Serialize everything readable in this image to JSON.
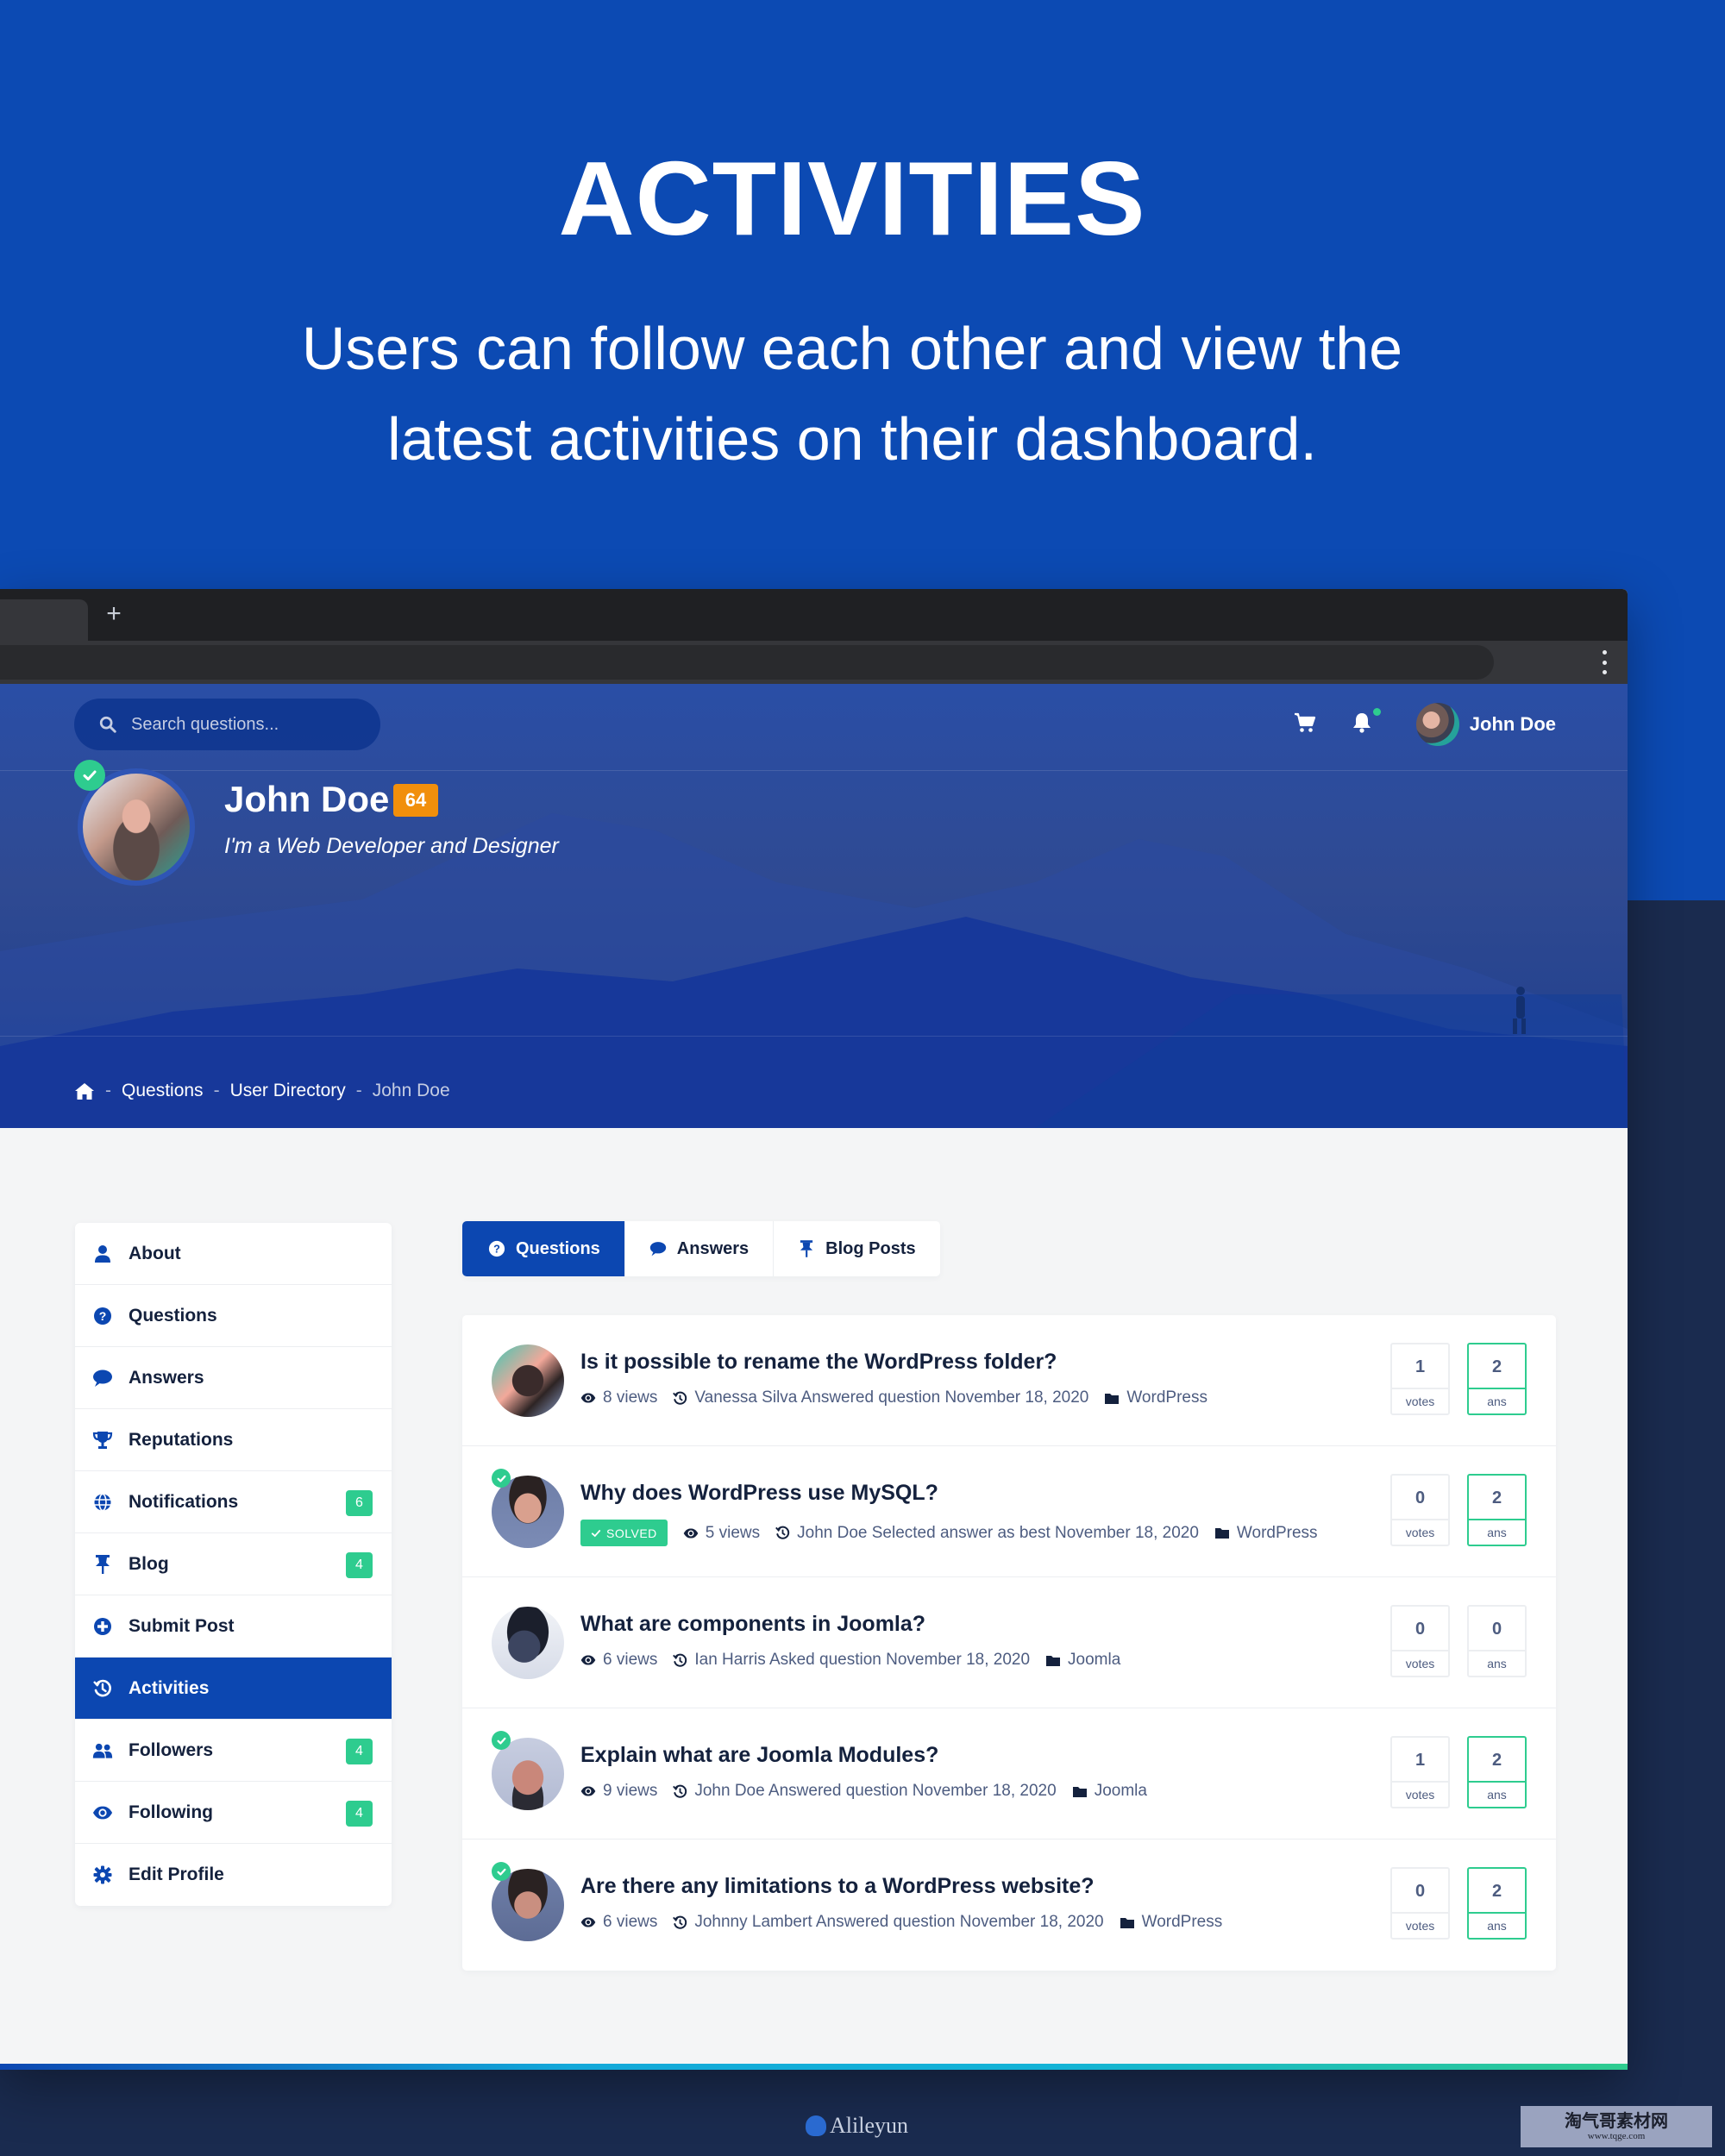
{
  "promo": {
    "title": "ACTIVITIES",
    "subtitle_line1": "Users can follow each other and view the",
    "subtitle_line2": "latest activities on their dashboard."
  },
  "browser": {
    "new_tab_label": "+"
  },
  "header": {
    "search_placeholder": "Search questions...",
    "user_name": "John Doe",
    "cart_icon": "cart-icon",
    "bell_icon": "bell-icon",
    "has_notification": true
  },
  "profile": {
    "name": "John Doe",
    "reputation": "64",
    "tagline": "I'm a Web Developer and Designer",
    "verified": true
  },
  "breadcrumb": {
    "home_icon": "home-icon",
    "sep": "-",
    "items": [
      "Questions",
      "User Directory"
    ],
    "current": "John Doe"
  },
  "sidebar": {
    "items": [
      {
        "label": "About",
        "icon": "user-icon"
      },
      {
        "label": "Questions",
        "icon": "question-circle-icon"
      },
      {
        "label": "Answers",
        "icon": "comment-icon"
      },
      {
        "label": "Reputations",
        "icon": "trophy-icon"
      },
      {
        "label": "Notifications",
        "icon": "globe-icon",
        "badge": "6"
      },
      {
        "label": "Blog",
        "icon": "pin-icon",
        "badge": "4"
      },
      {
        "label": "Submit Post",
        "icon": "plus-circle-icon"
      },
      {
        "label": "Activities",
        "icon": "history-icon",
        "active": true
      },
      {
        "label": "Followers",
        "icon": "users-icon",
        "badge": "4"
      },
      {
        "label": "Following",
        "icon": "eye-icon",
        "badge": "4"
      },
      {
        "label": "Edit Profile",
        "icon": "gear-icon"
      }
    ]
  },
  "tabs": [
    {
      "label": "Questions",
      "icon": "question-circle-icon",
      "active": true
    },
    {
      "label": "Answers",
      "icon": "comment-icon"
    },
    {
      "label": "Blog Posts",
      "icon": "pin-icon"
    }
  ],
  "questions": [
    {
      "title": "Is it possible to rename the WordPress folder?",
      "views": "8 views",
      "activity": "Vanessa Silva Answered question November 18, 2020",
      "category": "WordPress",
      "votes": "1",
      "votes_label": "votes",
      "answers": "2",
      "answers_label": "ans",
      "solved": false,
      "verified": false
    },
    {
      "title": "Why does WordPress use MySQL?",
      "solved_label": "SOLVED",
      "views": "5 views",
      "activity": "John Doe Selected answer as best November 18, 2020",
      "category": "WordPress",
      "votes": "0",
      "votes_label": "votes",
      "answers": "2",
      "answers_label": "ans",
      "solved": true,
      "verified": true
    },
    {
      "title": "What are components in Joomla?",
      "views": "6 views",
      "activity": "Ian Harris Asked question November 18, 2020",
      "category": "Joomla",
      "votes": "0",
      "votes_label": "votes",
      "answers": "0",
      "answers_label": "ans",
      "solved": false,
      "verified": false
    },
    {
      "title": "Explain what are Joomla Modules?",
      "views": "9 views",
      "activity": "John Doe Answered question November 18, 2020",
      "category": "Joomla",
      "votes": "1",
      "votes_label": "votes",
      "answers": "2",
      "answers_label": "ans",
      "solved": false,
      "verified": true
    },
    {
      "title": "Are there any limitations to a WordPress website?",
      "views": "6 views",
      "activity": "Johnny Lambert Answered question November 18, 2020",
      "category": "WordPress",
      "votes": "0",
      "votes_label": "votes",
      "answers": "2",
      "answers_label": "ans",
      "solved": false,
      "verified": true
    }
  ],
  "colors": {
    "brand_blue": "#0c47b1",
    "success_green": "#2ecc8f",
    "reputation_orange": "#f18f0c",
    "text_dark": "#14213d",
    "text_muted": "#4d5c80"
  },
  "watermarks": {
    "logo_text": "Alileyun",
    "box_line1": "淘气哥素材网",
    "box_line2": "www.tqge.com"
  }
}
